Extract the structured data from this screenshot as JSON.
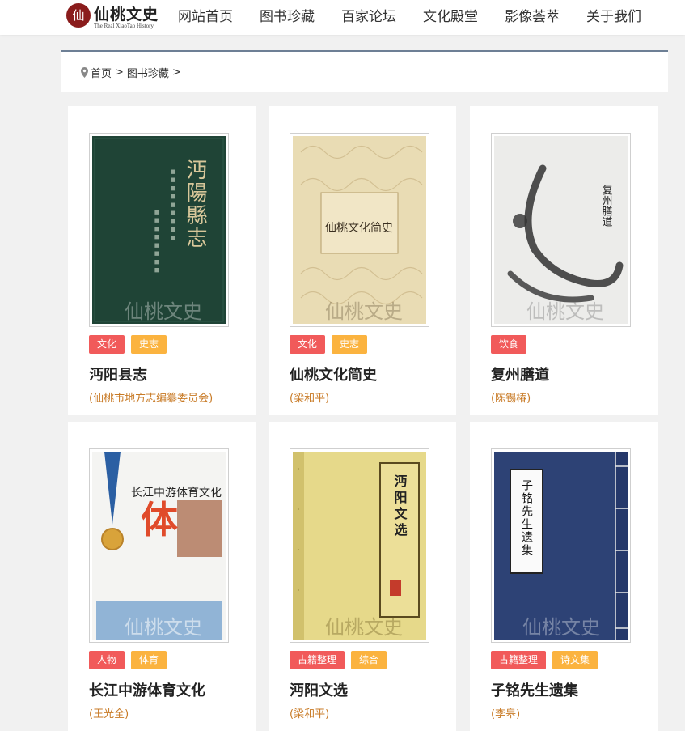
{
  "site": {
    "logo_mark": "仙",
    "logo_name": "仙桃文史",
    "logo_sub": "The Real XiaoTao History",
    "nav": [
      "网站首页",
      "图书珍藏",
      "百家论坛",
      "文化殿堂",
      "影像荟萃",
      "关于我们"
    ]
  },
  "breadcrumb": {
    "home": "首页",
    "separator": ">",
    "current": "图书珍藏",
    "trail_end": ">"
  },
  "colors": {
    "tag_red": "#f15a5a",
    "tag_orange": "#fbb33f",
    "author": "#c87a25"
  },
  "books": [
    {
      "cover_text": "沔陽縣志",
      "watermark": "仙桃文史",
      "tags": [
        {
          "label": "文化",
          "color": "red"
        },
        {
          "label": "史志",
          "color": "orange"
        }
      ],
      "title": "沔阳县志",
      "author": "(仙桃市地方志编纂委员会)"
    },
    {
      "cover_text": "仙桃文化简史",
      "watermark": "仙桃文史",
      "tags": [
        {
          "label": "文化",
          "color": "red"
        },
        {
          "label": "史志",
          "color": "orange"
        }
      ],
      "title": "仙桃文化简史",
      "author": "(梁和平)"
    },
    {
      "cover_text": "复州膳道",
      "watermark": "仙桃文史",
      "tags": [
        {
          "label": "饮食",
          "color": "red"
        }
      ],
      "title": "复州膳道",
      "author": "(陈锡椿)"
    },
    {
      "cover_text": "长江中游体育文化",
      "watermark": "仙桃文史",
      "tags": [
        {
          "label": "人物",
          "color": "red"
        },
        {
          "label": "体育",
          "color": "orange"
        }
      ],
      "title": "长江中游体育文化",
      "author": "(王光全)"
    },
    {
      "cover_text": "沔阳文选",
      "watermark": "仙桃文史",
      "tags": [
        {
          "label": "古籍整理",
          "color": "red"
        },
        {
          "label": "综合",
          "color": "orange"
        }
      ],
      "title": "沔阳文选",
      "author": "(梁和平)"
    },
    {
      "cover_text": "子铭先生遗集",
      "watermark": "仙桃文史",
      "tags": [
        {
          "label": "古籍整理",
          "color": "red"
        },
        {
          "label": "诗文集",
          "color": "orange"
        }
      ],
      "title": "子铭先生遗集",
      "author": "(李皋)"
    }
  ]
}
